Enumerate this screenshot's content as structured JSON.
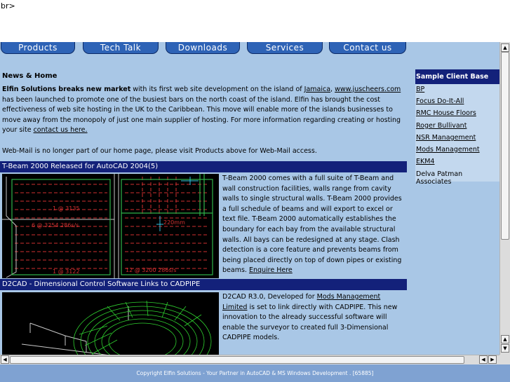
{
  "stray_text": "br>",
  "nav": {
    "tabs": [
      "Products",
      "Tech Talk",
      "Downloads",
      "Services",
      "Contact us"
    ]
  },
  "news": {
    "title": "News & Home",
    "headline": "Elfin Solutions breaks new market",
    "text1": " with its first web site development on the island of ",
    "link_jamaica": "Jamaica",
    "sep": ", ",
    "link_site": "www.juscheers.com",
    "text2": " has been launched to promote one of the busiest bars on the north coast of the island. Elfin has brought the cost effectiveness of web site hosting in the UK to the Caribbean. This move will enable more of the islands businesses to move away from the monopoly of just one main supplier of hosting. For more information regarding creating or hosting your site ",
    "link_contact": "contact us here."
  },
  "webmail": "Web-Mail is no longer part of our home page, please visit Products above for Web-Mail access.",
  "articles": [
    {
      "bar": "T-Beam 2000 Released for AutoCAD 2004(5)",
      "text": "T-Beam 2000 comes with a full suite of T-Beam and wall construction facilities, walls range from cavity walls to single structural walls. T-Beam 2000 provides a full schedule of beams and will export to excel or text file. T-Beam 2000 automatically establishes the boundary for each bay from the available structural walls. All bays can be redesigned at any stage. Clash detection is a core feature and prevents beams from being placed directly on top of down pipes or existing beams. ",
      "link": "Enquire Here",
      "cad_labels": [
        "1 @ 3135",
        "6 @ 3254  286s/s",
        "1 @ 3122",
        "12 @ 3200  286s/s",
        "220mm"
      ]
    },
    {
      "bar": "D2CAD - Dimensional Control Software Links to CADPIPE",
      "text1": "D2CAD R3.0, Developed for ",
      "link": "Mods Management Limited",
      "text2": " is set to link directly with CADPIPE. This new innovation to the already successful software will enable the surveyor to created full 3-Dimensional CADPIPE models."
    }
  ],
  "sidebar": {
    "title": "Sample Client Base",
    "clients": [
      {
        "name": "BP",
        "link": true
      },
      {
        "name": "Focus Do-It-All",
        "link": true
      },
      {
        "name": "RMC House Floors",
        "link": true
      },
      {
        "name": "Roger Bullivant",
        "link": true
      },
      {
        "name": "NSR Management",
        "link": true
      },
      {
        "name": "Mods Management",
        "link": true
      },
      {
        "name": "EKM4",
        "link": true
      },
      {
        "name": "Delva Patman Associates",
        "link": false
      }
    ]
  },
  "footer": "Copyright Elfin Solutions - Your Partner in AutoCAD & MS Windows Development . [65885]",
  "colors": {
    "frame_bg": "#a9c7e6",
    "bar_bg": "#13217a",
    "tab_bg": "#2e63b6",
    "footer_bg": "#7fa2d2"
  }
}
